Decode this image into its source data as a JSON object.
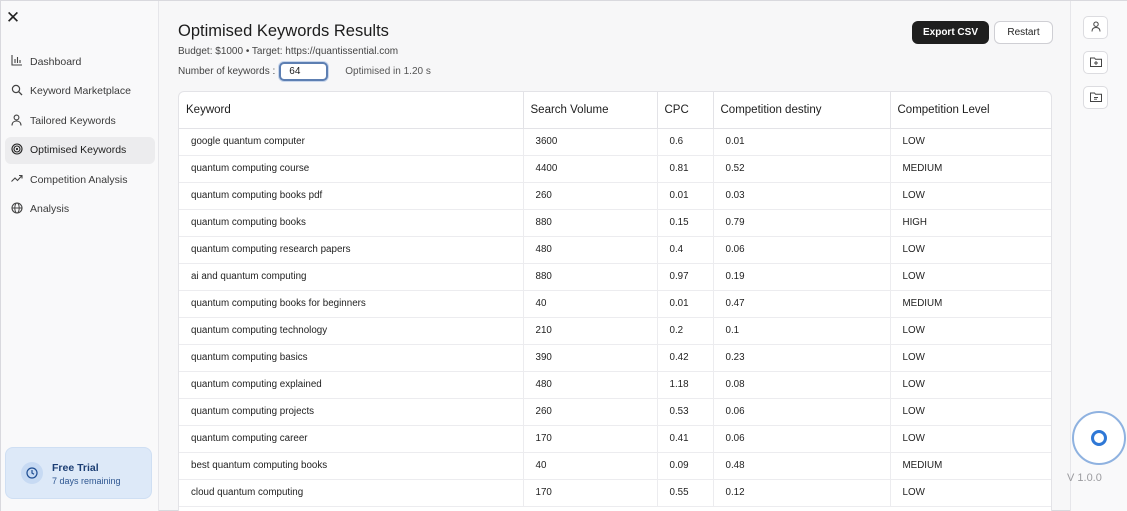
{
  "sidebar": {
    "items": [
      {
        "label": "Dashboard",
        "icon": "bar-chart-icon",
        "active": false
      },
      {
        "label": "Keyword Marketplace",
        "icon": "search-icon",
        "active": false
      },
      {
        "label": "Tailored Keywords",
        "icon": "user-icon",
        "active": false
      },
      {
        "label": "Optimised Keywords",
        "icon": "target-icon",
        "active": true
      },
      {
        "label": "Competition Analysis",
        "icon": "trend-icon",
        "active": false
      },
      {
        "label": "Analysis",
        "icon": "globe-icon",
        "active": false
      }
    ],
    "trial": {
      "title": "Free Trial",
      "subtitle": "7 days remaining",
      "icon": "clock-icon"
    }
  },
  "header": {
    "title": "Optimised Keywords Results",
    "meta": "Budget: $1000 • Target: https://quantissential.com",
    "keywords_label": "Number of keywords :",
    "keywords_value": "64",
    "optimised_text": "Optimised in 1.20 s",
    "export_label": "Export CSV",
    "restart_label": "Restart"
  },
  "table": {
    "columns": [
      "Keyword",
      "Search Volume",
      "CPC",
      "Competition destiny",
      "Competition Level"
    ],
    "rows": [
      [
        "google quantum computer",
        "3600",
        "0.6",
        "0.01",
        "LOW"
      ],
      [
        "quantum computing course",
        "4400",
        "0.81",
        "0.52",
        "MEDIUM"
      ],
      [
        "quantum computing books pdf",
        "260",
        "0.01",
        "0.03",
        "LOW"
      ],
      [
        "quantum computing books",
        "880",
        "0.15",
        "0.79",
        "HIGH"
      ],
      [
        "quantum computing research papers",
        "480",
        "0.4",
        "0.06",
        "LOW"
      ],
      [
        "ai and quantum computing",
        "880",
        "0.97",
        "0.19",
        "LOW"
      ],
      [
        "quantum computing books for beginners",
        "40",
        "0.01",
        "0.47",
        "MEDIUM"
      ],
      [
        "quantum computing technology",
        "210",
        "0.2",
        "0.1",
        "LOW"
      ],
      [
        "quantum computing basics",
        "390",
        "0.42",
        "0.23",
        "LOW"
      ],
      [
        "quantum computing explained",
        "480",
        "1.18",
        "0.08",
        "LOW"
      ],
      [
        "quantum computing projects",
        "260",
        "0.53",
        "0.06",
        "LOW"
      ],
      [
        "quantum computing career",
        "170",
        "0.41",
        "0.06",
        "LOW"
      ],
      [
        "best quantum computing books",
        "40",
        "0.09",
        "0.48",
        "MEDIUM"
      ],
      [
        "cloud quantum computing",
        "170",
        "0.55",
        "0.12",
        "LOW"
      ]
    ]
  },
  "rail": {
    "buttons": [
      "user-icon",
      "folder-add-icon",
      "folder-icon"
    ],
    "version": "V 1.0.0"
  },
  "colors": {
    "accent": "#2f78d6",
    "dark_button": "#1f1f1f",
    "trial_bg": "#dde9f8"
  }
}
